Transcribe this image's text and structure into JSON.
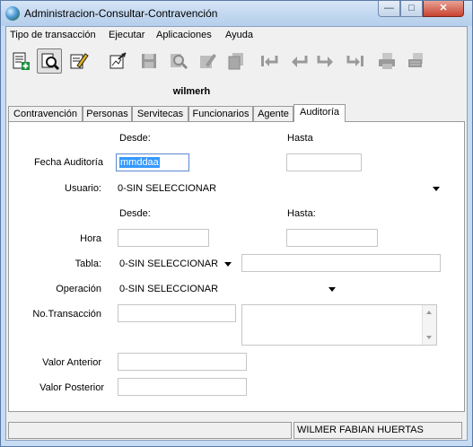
{
  "window": {
    "title": "Administracion-Consultar-Contravención"
  },
  "menu": [
    {
      "label": "Tipo de transacción"
    },
    {
      "label": "Ejecutar"
    },
    {
      "label": "Aplicaciones"
    },
    {
      "label": "Ayuda"
    }
  ],
  "toolbar": {
    "icons": [
      "new-record-icon",
      "query-icon",
      "edit-icon",
      "export-icon",
      "save-icon",
      "search-icon",
      "execute-icon",
      "copy-icon",
      "first-icon",
      "previous-icon",
      "next-icon",
      "last-icon",
      "print-icon",
      "print-list-icon"
    ]
  },
  "user": {
    "name": "wilmerh"
  },
  "tabs": [
    {
      "label": "Contravención"
    },
    {
      "label": "Personas"
    },
    {
      "label": "Servitecas"
    },
    {
      "label": "Funcionarios"
    },
    {
      "label": "Agente"
    },
    {
      "label": "Auditoría"
    }
  ],
  "form": {
    "desde_label_1": "Desde:",
    "hasta_label_1": "Hasta",
    "fecha_label": "Fecha Auditoría",
    "fecha_desde_value": "mmddaa",
    "fecha_hasta_value": "",
    "usuario_label": "Usuario:",
    "usuario_value": "0-SIN SELECCIONAR",
    "desde_label_2": "Desde:",
    "hasta_label_2": "Hasta:",
    "hora_label": "Hora",
    "hora_desde_value": "",
    "hora_hasta_value": "",
    "tabla_label": "Tabla:",
    "tabla_value": "0-SIN SELECCIONAR",
    "tabla_text_value": "",
    "operacion_label": "Operación",
    "operacion_value": "0-SIN SELECCIONAR",
    "transaccion_label": "No.Transacción",
    "transaccion_value": "",
    "transaccion_detail": "",
    "valor_anterior_label": "Valor Anterior",
    "valor_anterior_value": "",
    "valor_posterior_label": "Valor Posterior",
    "valor_posterior_value": ""
  },
  "status": {
    "left": "",
    "user_fullname": "WILMER FABIAN HUERTAS"
  }
}
